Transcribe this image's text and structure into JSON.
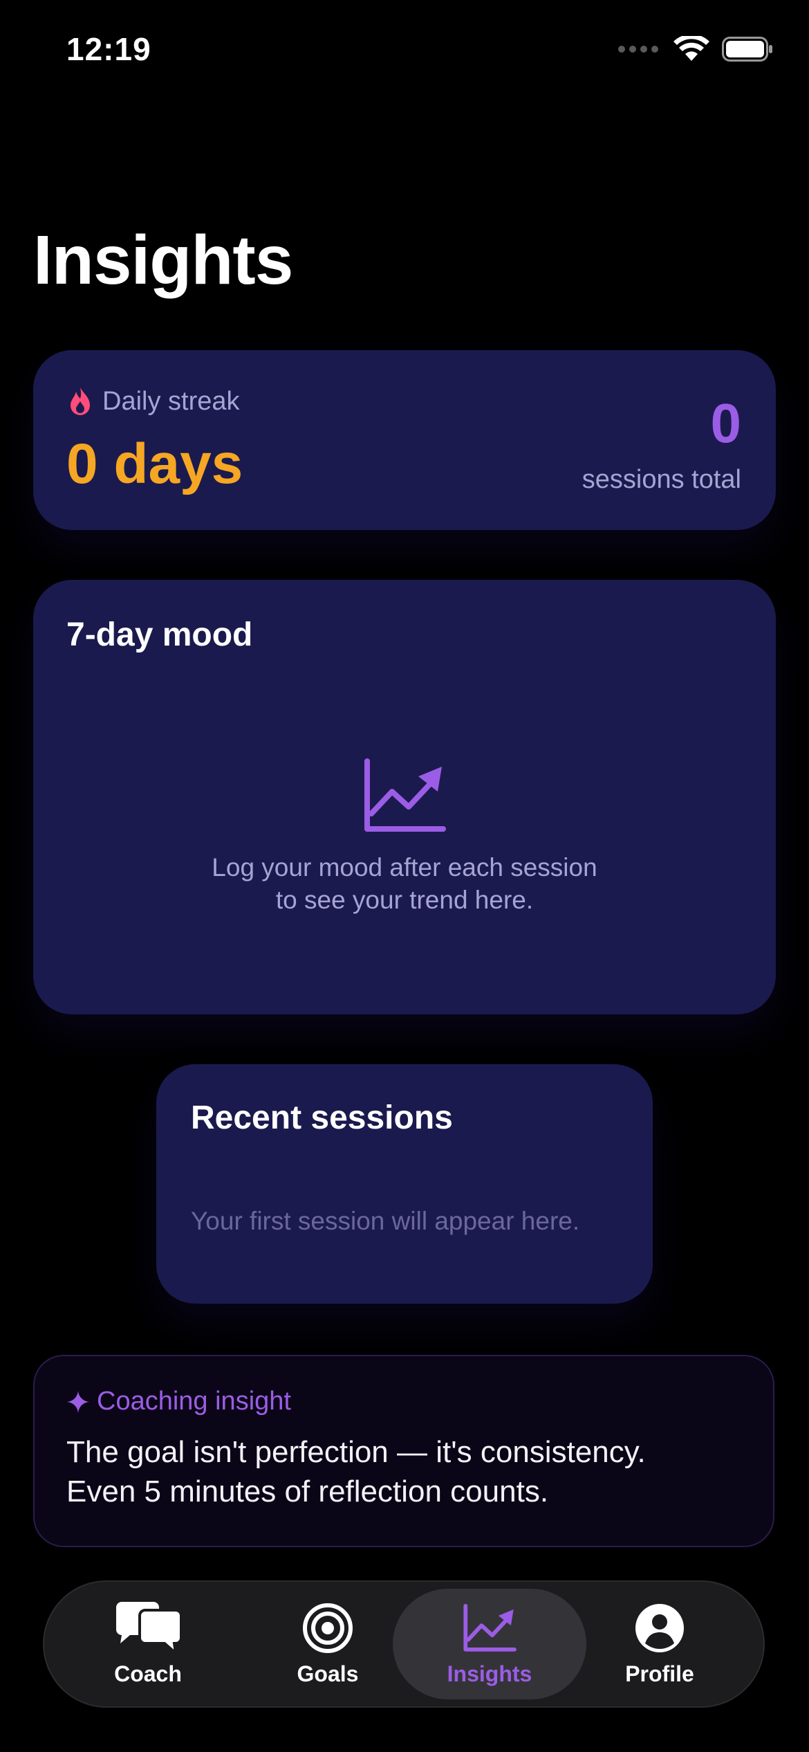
{
  "status_bar": {
    "time": "12:19"
  },
  "page": {
    "title": "Insights"
  },
  "streak": {
    "label": "Daily streak",
    "value": "0 days",
    "sessions_count": "0",
    "sessions_label": "sessions total"
  },
  "mood": {
    "title": "7-day mood",
    "empty_line1": "Log your mood after each session",
    "empty_line2": "to see your trend here."
  },
  "recent": {
    "title": "Recent sessions",
    "empty": "Your first session will appear here."
  },
  "insight": {
    "label": "Coaching insight",
    "line1": "The goal isn't perfection — it's consistency.",
    "line2": "Even 5 minutes of reflection counts."
  },
  "tabs": [
    {
      "label": "Coach",
      "icon": "chat-bubbles-icon",
      "active": false
    },
    {
      "label": "Goals",
      "icon": "target-icon",
      "active": false
    },
    {
      "label": "Insights",
      "icon": "trend-chart-icon",
      "active": true
    },
    {
      "label": "Profile",
      "icon": "person-circle-icon",
      "active": false
    }
  ],
  "colors": {
    "background": "#000000",
    "card": "#1b1a4e",
    "accent_purple": "#9b5de5",
    "streak_orange": "#f5a623",
    "flame_pink": "#ff4d7a",
    "muted_text": "#a7a4d4"
  }
}
